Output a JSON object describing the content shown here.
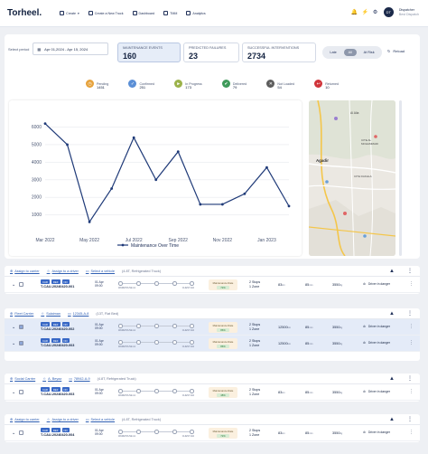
{
  "brand": "Torheel.",
  "nav": [
    {
      "label": "Create",
      "icon": "plus-icon"
    },
    {
      "label": "Create a New Truck",
      "icon": "truck-icon"
    },
    {
      "label": "Dashboard",
      "icon": "grid-icon"
    },
    {
      "label": "TMM",
      "icon": "map-icon"
    },
    {
      "label": "Analytics",
      "icon": "chart-icon"
    }
  ],
  "user": {
    "initials": "DT",
    "name": "Dispatcher",
    "role": "Best Dispatch"
  },
  "filters": {
    "period_label": "Select period",
    "date_range": "Apr 01,2024 - Apr 15, 2024"
  },
  "kpis": [
    {
      "label": "Maintenance events",
      "value": "160"
    },
    {
      "label": "Predicted failures",
      "value": "23"
    },
    {
      "label": "Successful interventions",
      "value": "2734"
    }
  ],
  "toggle": {
    "options": [
      "Late",
      "All",
      "At Risk"
    ],
    "selected": "All"
  },
  "reload_label": "Reload",
  "statuses": [
    {
      "name": "Pending",
      "count": "1451",
      "color": "#e6a23c",
      "icon": "clock-icon"
    },
    {
      "name": "Confirmed",
      "count": "251",
      "color": "#5b8fd6",
      "icon": "check-circle-icon"
    },
    {
      "name": "In Progress",
      "count": "173",
      "color": "#9bb24a",
      "icon": "progress-icon"
    },
    {
      "name": "Delivered",
      "count": "79",
      "color": "#3f9a5a",
      "icon": "checkmark-icon"
    },
    {
      "name": "Not Loaded",
      "count": "54",
      "color": "#5d5d5d",
      "icon": "x-icon"
    },
    {
      "name": "Returned",
      "count": "10",
      "color": "#d0343a",
      "icon": "return-icon"
    }
  ],
  "chart_data": {
    "type": "line",
    "x": [
      "Mar 2022",
      "Apr 2022",
      "May 2022",
      "Jun 2022",
      "Jul 2022",
      "Aug 2022",
      "Sep 2022",
      "Oct 2022",
      "Nov 2022",
      "Dec 2022",
      "Jan 2023",
      "Feb 2023"
    ],
    "xticks": [
      "Mar 2022",
      "May 2022",
      "Jul 2022",
      "Sep 2022",
      "Nov 2022",
      "Jan 2023"
    ],
    "series": [
      {
        "name": "Maintenance Over Time",
        "values": [
          6200,
          5000,
          600,
          2500,
          5400,
          3000,
          4600,
          1600,
          1600,
          2200,
          3700,
          1500
        ]
      }
    ],
    "yticks": [
      1000,
      2000,
      3000,
      4000,
      5000,
      6000
    ],
    "ylim": [
      0,
      6800
    ],
    "legend": "bottom-center",
    "grid": true,
    "color": "#1f3a78"
  },
  "map": {
    "labels": [
      "Al Alia",
      "Agadir",
      "CITE AL MOHAMMADI",
      "CITE DAKHLA"
    ]
  },
  "groups": [
    {
      "assign_carrier": "Assign to carrier",
      "assign_driver": "Assign to a driver",
      "select_vehicle": "Select a vehicle",
      "vehicle_desc": "(4.8T, Refrigerated Truck)",
      "rows": [
        {
          "tags": [
            "CAR",
            "REF",
            "NO"
          ],
          "id": "T-CAU-20240420-001",
          "date": "01 Apr",
          "time": "09:00",
          "origin": "WAREHOUSE A1",
          "dest": "CLIENT A02",
          "rate_label": "Maintenance Rate",
          "rate": "72%",
          "stops": "2 Stops",
          "zone": "1 Zone",
          "km": "83",
          "mins": "85",
          "kg": "3550",
          "danger": "Driver in danger",
          "selected": false
        }
      ]
    },
    {
      "assign_carrier": "Fleet Carrier",
      "assign_driver": "Sulaiman",
      "select_vehicle": "12345-A-8",
      "vehicle_desc": "(13T, Flat Bed)",
      "rows": [
        {
          "tags": [
            "CAR",
            "REF",
            "NO"
          ],
          "id": "T-CAU-20240420-002",
          "date": "01 Apr",
          "time": "09:00",
          "origin": "WAREHOUSE A1",
          "dest": "CLIENT A02",
          "rate_label": "Maintenance Rate",
          "rate": "86%",
          "stops": "2 Stops",
          "zone": "1 Zone",
          "km": "12500",
          "mins": "85",
          "kg": "3550",
          "danger": "Driver in danger",
          "selected": true
        },
        {
          "tags": [
            "CAR",
            "REF",
            "NO"
          ],
          "id": "T-CAU-20240420-003",
          "date": "01 Apr",
          "time": "09:00",
          "origin": "WAREHOUSE A1",
          "dest": "CLIENT A02",
          "rate_label": "Maintenance Rate",
          "rate": "86%",
          "stops": "2 Stops",
          "zone": "1 Zone",
          "km": "12500",
          "mins": "85",
          "kg": "3550",
          "danger": "Driver in danger",
          "selected": true
        }
      ]
    },
    {
      "assign_carrier": "Social Carrier",
      "assign_driver": "A. Beyaz",
      "select_vehicle": "78942-A-9",
      "vehicle_desc": "(4.8T, Refrigerated Truck)",
      "rows": [
        {
          "tags": [
            "CAR",
            "REF",
            "NO"
          ],
          "id": "T-CAU-20240420-003",
          "date": "01 Apr",
          "time": "09:00",
          "origin": "WAREHOUSE A1",
          "dest": "CLIENT A02",
          "rate_label": "Maintenance Rate",
          "rate": "48%",
          "stops": "2 Stops",
          "zone": "1 Zone",
          "km": "83",
          "mins": "85",
          "kg": "3550",
          "danger": "Driver in danger",
          "selected": false
        }
      ]
    },
    {
      "assign_carrier": "Assign to carrier",
      "assign_driver": "Assign to a driver",
      "select_vehicle": "Select a vehicle",
      "vehicle_desc": "(4.8T, Refrigerated Truck)",
      "rows": [
        {
          "tags": [
            "CAR",
            "REF",
            "NO"
          ],
          "id": "T-CAU-20240420-004",
          "date": "01 Apr",
          "time": "09:00",
          "origin": "WAREHOUSE A1",
          "dest": "CLIENT A02",
          "rate_label": "Maintenance Rate",
          "rate": "72%",
          "stops": "2 Stops",
          "zone": "1 Zone",
          "km": "83",
          "mins": "85",
          "kg": "3550",
          "danger": "Driver in danger",
          "selected": false
        }
      ]
    }
  ]
}
